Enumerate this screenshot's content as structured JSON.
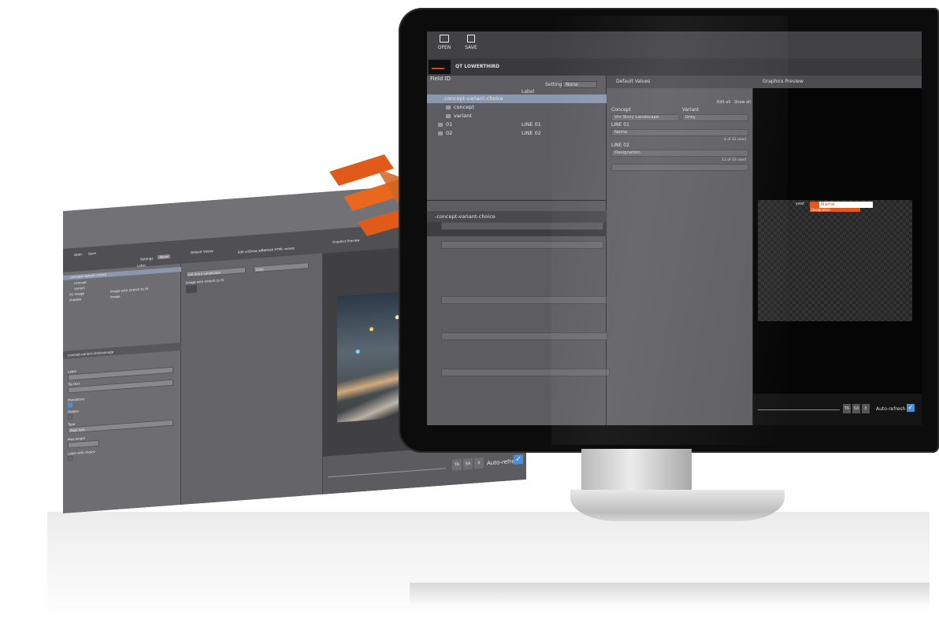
{
  "toolbar": {
    "open_label": "OPEN",
    "save_label": "SAVE"
  },
  "document": {
    "title": "QT LOWERTHIRD"
  },
  "fields": {
    "header": "Field ID",
    "settings_label": "Settings",
    "settings_value": "None",
    "label_header": "Label",
    "tree": [
      {
        "name": "-concept-variant-choice",
        "label": "",
        "selected": true
      },
      {
        "name": "concept",
        "label": "",
        "selected": false
      },
      {
        "name": "variant",
        "label": "",
        "selected": false
      },
      {
        "name": "01",
        "label": "LINE 01",
        "selected": false
      },
      {
        "name": "02",
        "label": "LINE 02",
        "selected": false
      }
    ],
    "properties_header": "-concept-variant-choice"
  },
  "defaults": {
    "header": "Default Values",
    "edit_all": "Edit all",
    "show_all": "Show all",
    "concept_label": "Concept",
    "concept_value": "Vnl Story Landscape",
    "variant_label": "Variant",
    "variant_value": "Grey",
    "line1_label": "LINE 01",
    "line1_value": "Name",
    "line1_used": "4 of 22 used",
    "line2_label": "LINE 02",
    "line2_value": "Designation",
    "line2_used": "11 of 33 used"
  },
  "preview": {
    "header": "Graphics Preview",
    "name_text": "Name",
    "designation_text": "Designation",
    "prefix": "yeaf",
    "btn_ta": "TA",
    "btn_sa": "SA",
    "btn_x": "X",
    "auto_refresh": "Auto-refresh"
  },
  "window2": {
    "open_label": "Open",
    "save_label": "Save",
    "settings_label": "Settings",
    "settings_value": "None",
    "label_header": "Label",
    "tree": [
      "-concept-variant-choice",
      "concept",
      "variant",
      "01-image",
      "shadow"
    ],
    "default_values": "Default Values",
    "edit_all": "Edit all",
    "show_all": "Show all",
    "refresh_html": "Refresh HTML values",
    "graphics_preview": "Graphics Preview",
    "concept_value": "Vnl Story Landscape",
    "variant_value": "Grey",
    "image_label": "Image with stretch to fit",
    "image_text": "Image",
    "btn_ta": "TA",
    "btn_sa": "SA",
    "btn_x": "X",
    "auto_refresh": "Auto-refresh",
    "prop_header": "concept-variant-choiceimage",
    "labels": [
      "Label",
      "Tip text",
      "Mandatory",
      "Hidden",
      "Type",
      "Plain text",
      "Max length",
      "Label with choice"
    ]
  },
  "colors": {
    "accent": "#e05a1c",
    "checkbox": "#4a90d9",
    "selection": "#8a97ad"
  },
  "icons": [
    "folder-open-icon",
    "save-icon",
    "folder-icon",
    "graphics-preview-icon",
    "checkbox-icon",
    "logo-mark-icon"
  ]
}
